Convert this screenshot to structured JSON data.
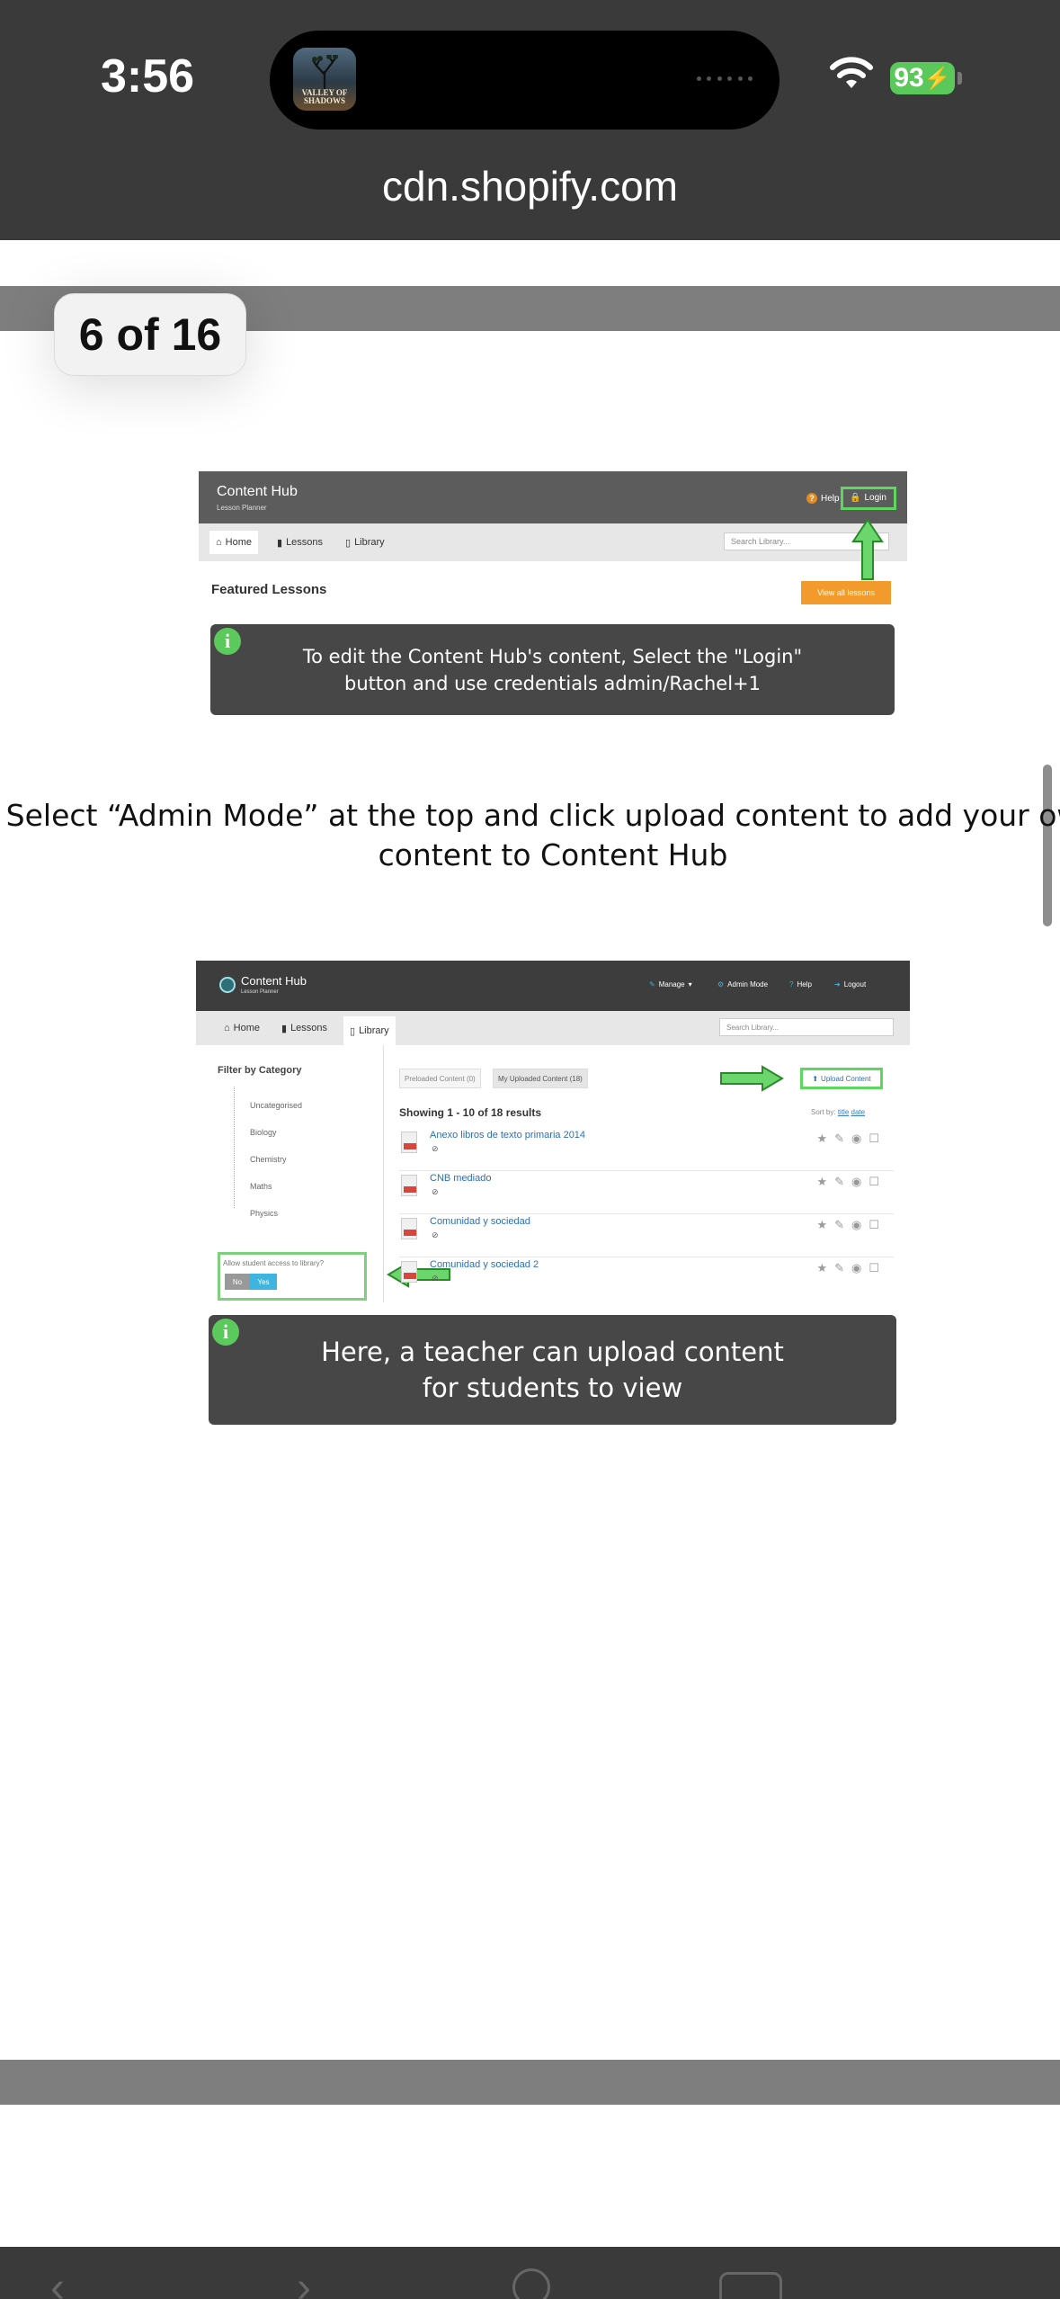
{
  "status_bar": {
    "time": "3:56",
    "now_playing_art_text": "VALLEY OF SHADOWS",
    "battery": "93",
    "icons": [
      "wifi-icon",
      "battery-charging-icon"
    ]
  },
  "browser": {
    "url": "cdn.shopify.com"
  },
  "pdf": {
    "page_indicator": "6 of 16",
    "caption": "Select “Admin Mode” at the top and click upload content to add your own content to Content Hub"
  },
  "screenshot1": {
    "app_title": "Content Hub",
    "app_subtitle": "Lesson Planner",
    "help": "Help",
    "login": "Login",
    "tabs": [
      "Home",
      "Lessons",
      "Library"
    ],
    "search_placeholder": "Search Library...",
    "featured": "Featured Lessons",
    "view_all": "View all lessons",
    "info_icon": "i",
    "info_line1": "To edit the Content Hub's content, Select the \"Login\"",
    "info_line2": "button and use credentials admin/Rachel+1"
  },
  "screenshot2": {
    "app_title": "Content Hub",
    "app_subtitle": "Lesson Planner",
    "header_links": [
      "Manage",
      "Admin Mode",
      "Help",
      "Logout"
    ],
    "tabs": [
      "Home",
      "Lessons",
      "Library"
    ],
    "search_placeholder": "Search Library...",
    "filter_title": "Filter by Category",
    "categories": [
      "Uncategorised",
      "Biology",
      "Chemistry",
      "Maths",
      "Physics"
    ],
    "allow_label": "Allow student access to library?",
    "toggle_no": "No",
    "toggle_yes": "Yes",
    "subtabs": [
      "Preloaded Content (0)",
      "My Uploaded Content (18)"
    ],
    "upload": "Upload Content",
    "results": "Showing 1 - 10 of 18 results",
    "sort_by": "Sort by:",
    "sort_title": "title",
    "sort_date": "date",
    "files": [
      {
        "name": "Anexo libros de texto primaria 2014",
        "sub": "⊘"
      },
      {
        "name": "CNB mediado",
        "sub": "⊘"
      },
      {
        "name": "Comunidad y sociedad",
        "sub": "⊘"
      },
      {
        "name": "Comunidad y sociedad 2",
        "sub": "⊘"
      }
    ],
    "info_icon": "i",
    "info_line1": "Here, a teacher can upload content",
    "info_line2": "for students to view"
  },
  "toolbar": {
    "icons": [
      "back-icon",
      "forward-icon",
      "share-icon",
      "tabs-icon"
    ]
  }
}
